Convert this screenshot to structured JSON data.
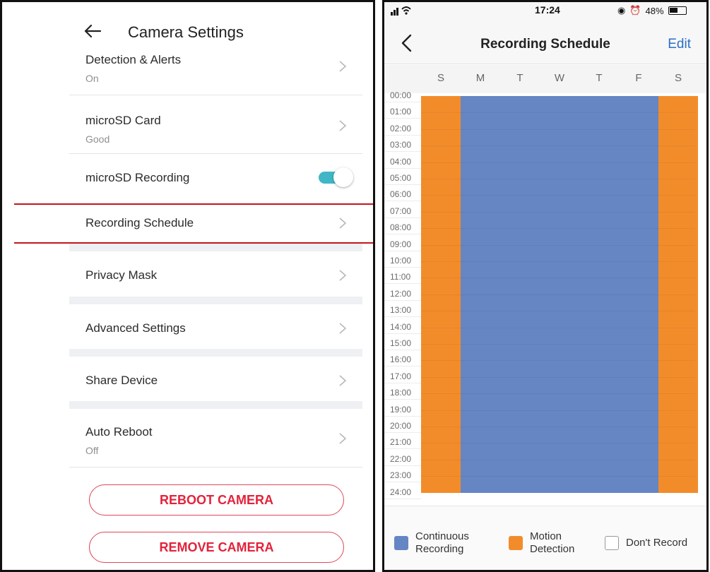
{
  "left": {
    "title": "Camera Settings",
    "items": [
      {
        "label": "Detection & Alerts",
        "sub": "On"
      },
      {
        "label": "microSD Card",
        "sub": "Good"
      },
      {
        "label": "microSD Recording"
      },
      {
        "label": "Recording Schedule"
      },
      {
        "label": "Privacy Mask"
      },
      {
        "label": "Advanced Settings"
      },
      {
        "label": "Share Device"
      },
      {
        "label": "Auto Reboot",
        "sub": "Off"
      }
    ],
    "microsd_recording_on": true,
    "buttons": {
      "reboot": "REBOOT CAMERA",
      "remove": "REMOVE CAMERA"
    },
    "accent_color": "#3fb7c6",
    "danger_color": "#e3223a",
    "highlight_color": "#c4161c"
  },
  "right": {
    "status": {
      "time": "17:24",
      "battery": "48%"
    },
    "nav": {
      "title": "Recording Schedule",
      "edit": "Edit"
    },
    "days": [
      "S",
      "M",
      "T",
      "W",
      "T",
      "F",
      "S"
    ],
    "hours": [
      "00:00",
      "01:00",
      "02:00",
      "03:00",
      "04:00",
      "05:00",
      "06:00",
      "07:00",
      "08:00",
      "09:00",
      "10:00",
      "11:00",
      "12:00",
      "13:00",
      "14:00",
      "15:00",
      "16:00",
      "17:00",
      "18:00",
      "19:00",
      "20:00",
      "21:00",
      "22:00",
      "23:00",
      "24:00"
    ],
    "schedule": [
      "motion",
      "continuous",
      "continuous",
      "continuous",
      "continuous",
      "continuous",
      "motion"
    ],
    "colors": {
      "continuous": "#6586c3",
      "motion": "#f28c2b"
    },
    "legend": [
      {
        "key": "continuous",
        "line1": "Continuous",
        "line2": "Recording"
      },
      {
        "key": "motion",
        "line1": "Motion",
        "line2": "Detection"
      },
      {
        "key": "none",
        "line1": "Don't Record",
        "line2": ""
      }
    ]
  }
}
